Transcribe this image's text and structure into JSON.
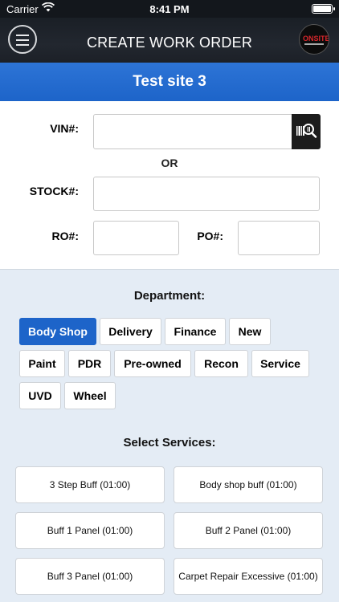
{
  "status_bar": {
    "carrier": "Carrier",
    "time": "8:41 PM"
  },
  "nav": {
    "title": "CREATE WORK ORDER",
    "menu_icon": "hamburger-icon",
    "logo_text": "ONSITE"
  },
  "site": {
    "name": "Test site 3"
  },
  "form": {
    "vin_label": "VIN#:",
    "vin_value": "",
    "or_text": "OR",
    "stock_label": "STOCK#:",
    "stock_value": "",
    "ro_label": "RO#:",
    "ro_value": "",
    "po_label": "PO#:",
    "po_value": "",
    "scan_icon": "barcode-scan-icon"
  },
  "department": {
    "title": "Department:",
    "selected": "Body Shop",
    "items": [
      "Body Shop",
      "Delivery",
      "Finance",
      "New",
      "Paint",
      "PDR",
      "Pre-owned",
      "Recon",
      "Service",
      "UVD",
      "Wheel"
    ]
  },
  "services": {
    "title": "Select Services:",
    "items": [
      "3 Step Buff (01:00)",
      "Body shop buff (01:00)",
      "Buff 1 Panel (01:00)",
      "Buff 2 Panel (01:00)",
      "Buff 3 Panel (01:00)",
      "Carpet Repair Excessive (01:00)"
    ]
  },
  "colors": {
    "accent": "#1d64c9",
    "navbar": "#1c2027",
    "panel": "#e4ecf5"
  }
}
